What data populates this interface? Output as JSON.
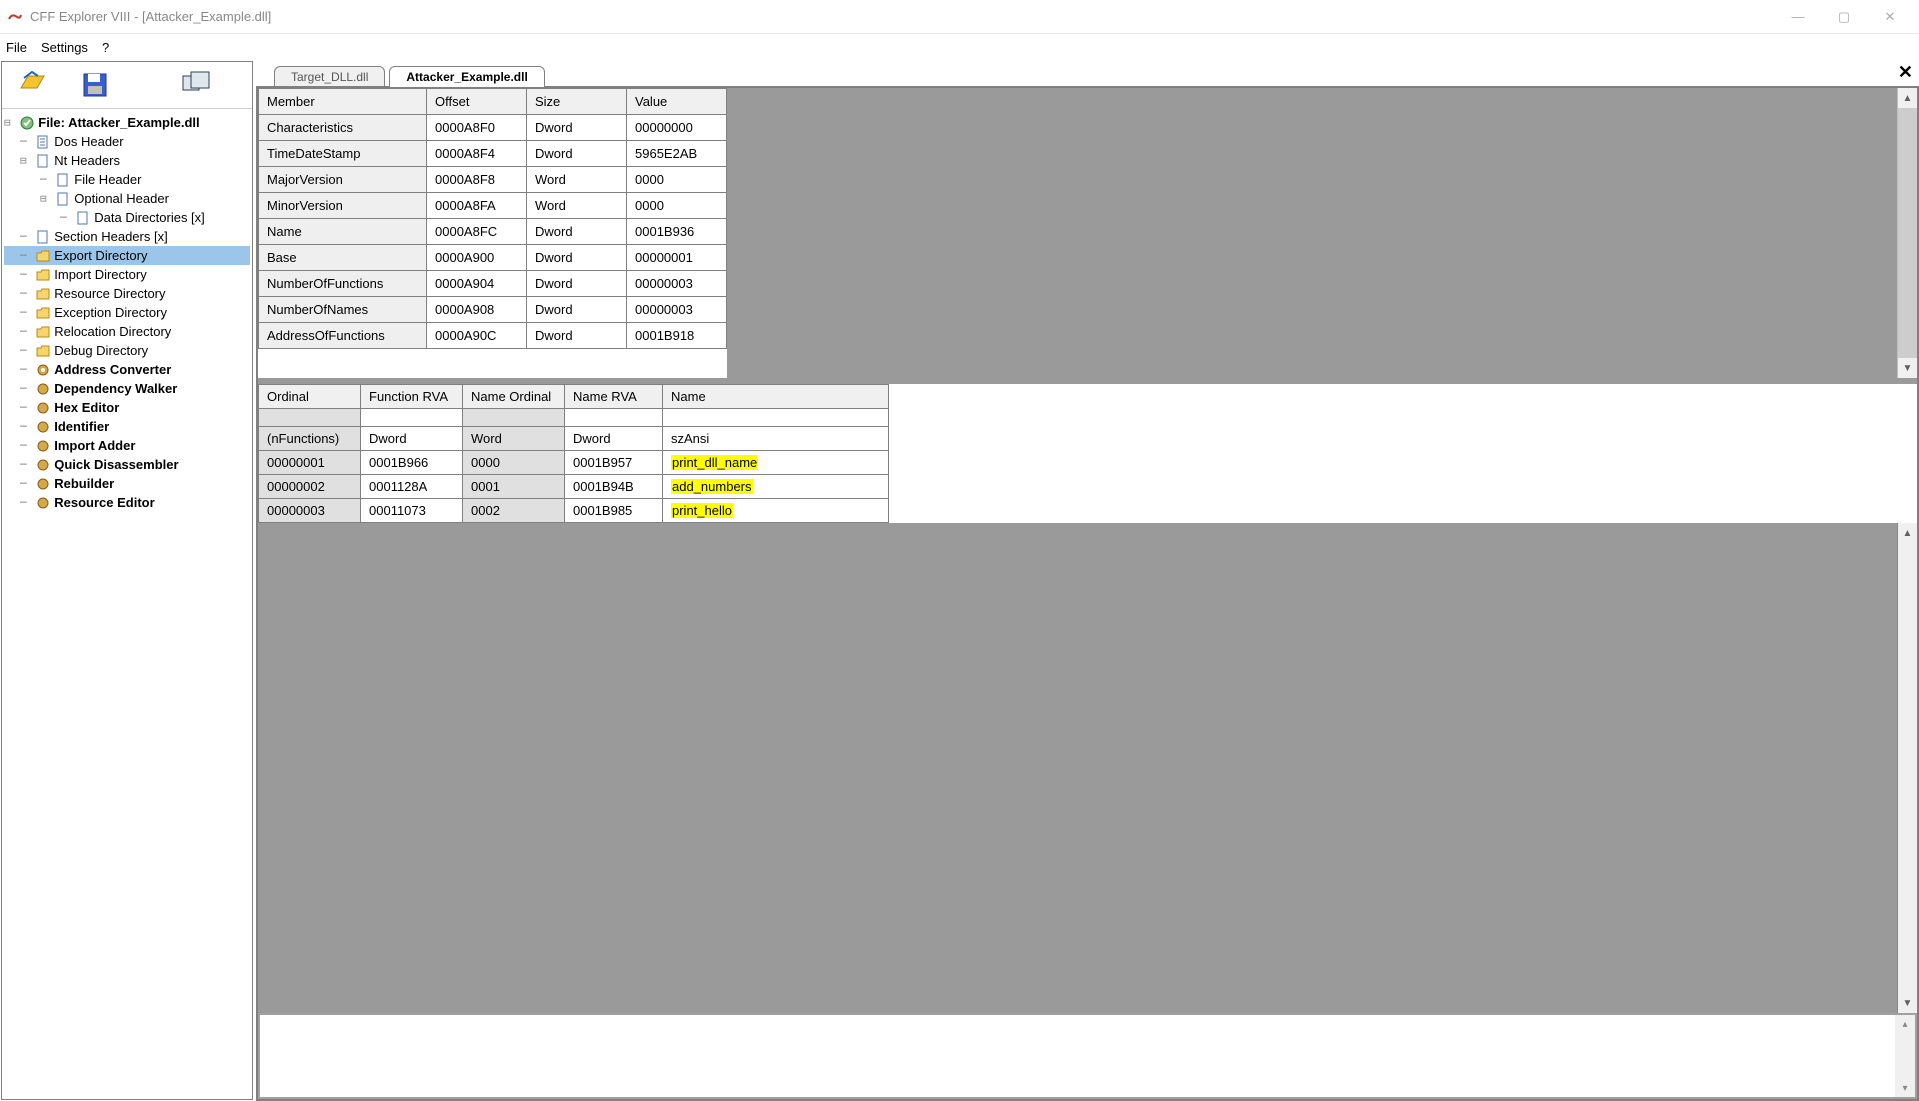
{
  "app": {
    "icon_name": "app-icon",
    "title": "CFF Explorer VIII - [Attacker_Example.dll]"
  },
  "window_controls": {
    "min": "—",
    "max": "▢",
    "close": "✕"
  },
  "menu": {
    "file": "File",
    "settings": "Settings",
    "help": "?"
  },
  "tabs": {
    "inactive": "Target_DLL.dll",
    "active": "Attacker_Example.dll",
    "close": "✕"
  },
  "tree": {
    "root": "File: Attacker_Example.dll",
    "dos": "Dos Header",
    "nt": "Nt Headers",
    "fileh": "File Header",
    "opth": "Optional Header",
    "datadirs": "Data Directories [x]",
    "secth": "Section Headers [x]",
    "exportd": "Export Directory",
    "importd": "Import Directory",
    "resd": "Resource Directory",
    "excd": "Exception Directory",
    "reld": "Relocation Directory",
    "dbgd": "Debug Directory",
    "addrconv": "Address Converter",
    "depw": "Dependency Walker",
    "hexe": "Hex Editor",
    "ident": "Identifier",
    "impadd": "Import Adder",
    "qdis": "Quick Disassembler",
    "reb": "Rebuilder",
    "rese": "Resource Editor"
  },
  "members_table": {
    "headers": {
      "member": "Member",
      "offset": "Offset",
      "size": "Size",
      "value": "Value"
    },
    "rows": [
      {
        "member": "Characteristics",
        "offset": "0000A8F0",
        "size": "Dword",
        "value": "00000000"
      },
      {
        "member": "TimeDateStamp",
        "offset": "0000A8F4",
        "size": "Dword",
        "value": "5965E2AB"
      },
      {
        "member": "MajorVersion",
        "offset": "0000A8F8",
        "size": "Word",
        "value": "0000"
      },
      {
        "member": "MinorVersion",
        "offset": "0000A8FA",
        "size": "Word",
        "value": "0000"
      },
      {
        "member": "Name",
        "offset": "0000A8FC",
        "size": "Dword",
        "value": "0001B936"
      },
      {
        "member": "Base",
        "offset": "0000A900",
        "size": "Dword",
        "value": "00000001"
      },
      {
        "member": "NumberOfFunctions",
        "offset": "0000A904",
        "size": "Dword",
        "value": "00000003"
      },
      {
        "member": "NumberOfNames",
        "offset": "0000A908",
        "size": "Dword",
        "value": "00000003"
      },
      {
        "member": "AddressOfFunctions",
        "offset": "0000A90C",
        "size": "Dword",
        "value": "0001B918"
      }
    ]
  },
  "exports_table": {
    "headers": {
      "ord": "Ordinal",
      "frva": "Function RVA",
      "nord": "Name Ordinal",
      "nrva": "Name RVA",
      "name": "Name"
    },
    "types": {
      "ord": "(nFunctions)",
      "frva": "Dword",
      "nord": "Word",
      "nrva": "Dword",
      "name": "szAnsi"
    },
    "rows": [
      {
        "ord": "00000001",
        "frva": "0001B966",
        "nord": "0000",
        "nrva": "0001B957",
        "name": "print_dll_name"
      },
      {
        "ord": "00000002",
        "frva": "0001128A",
        "nord": "0001",
        "nrva": "0001B94B",
        "name": "add_numbers"
      },
      {
        "ord": "00000003",
        "frva": "00011073",
        "nord": "0002",
        "nrva": "0001B985",
        "name": "print_hello"
      }
    ]
  }
}
